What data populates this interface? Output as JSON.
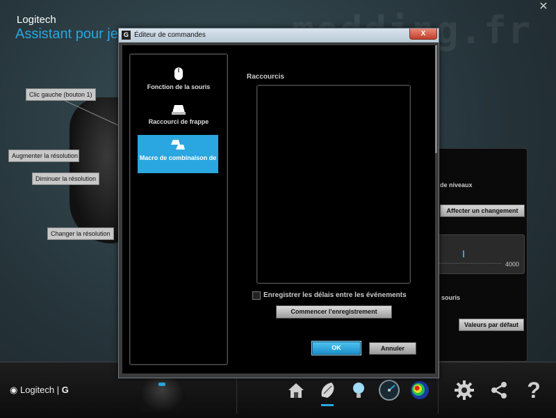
{
  "app": {
    "title": "Logitech",
    "subtitle": "Assistant pour jeux",
    "watermark": "modding.fr"
  },
  "callouts": {
    "left_click": "Clic gauche (bouton 1)",
    "increase_res": "Augmenter la résolution",
    "decrease_res": "Diminuer la résolution",
    "change_res": "Changer la résolution"
  },
  "right_panel": {
    "levels_label": "de niveaux",
    "assign_button": "Affecter un changement",
    "slider_max": "4000",
    "mouse_label": "souris",
    "defaults_button": "Valeurs par défaut"
  },
  "dialog": {
    "title": "Éditeur de commandes",
    "close_label": "X",
    "sidebar": [
      {
        "label": "Fonction de la souris",
        "icon": "mouse-icon"
      },
      {
        "label": "Raccourci de frappe",
        "icon": "key-icon"
      },
      {
        "label": "Macro de combinaison de",
        "icon": "keys-combo-icon",
        "active": true
      }
    ],
    "shortcuts_label": "Raccourcis",
    "record_delays_label": "Enregistrer les délais entre les événements",
    "record_delays_checked": false,
    "start_recording": "Commencer l'enregistrement",
    "ok": "OK",
    "cancel": "Annuler"
  },
  "bottom": {
    "logo_text": "Logitech",
    "logo_mark": "G",
    "nav": [
      "home-icon",
      "mouse-pointer-icon",
      "lighting-icon",
      "speedometer-icon",
      "heatmap-icon",
      "settings-icon",
      "share-icon",
      "help-icon"
    ]
  },
  "colors": {
    "accent": "#2aa7e0",
    "background": "#26353b"
  }
}
